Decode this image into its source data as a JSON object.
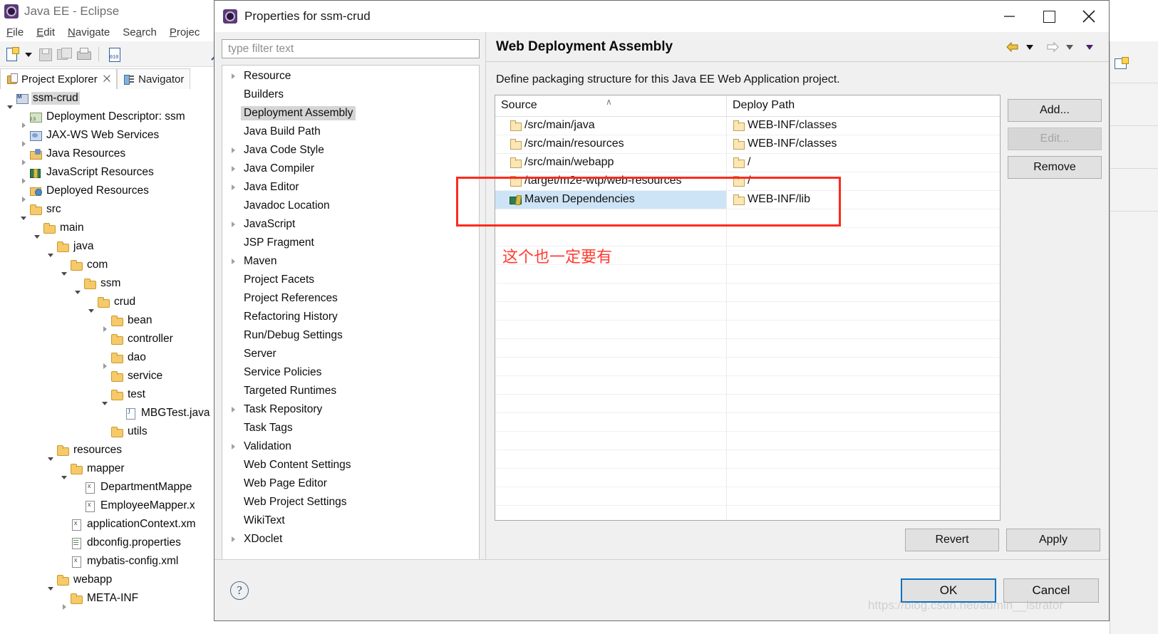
{
  "eclipse": {
    "window_title": "Java EE - Eclipse",
    "logo_icon": "eclipse-logo-icon",
    "menus": [
      {
        "label": "File",
        "mnemonic": "F"
      },
      {
        "label": "Edit",
        "mnemonic": "E"
      },
      {
        "label": "Navigate",
        "mnemonic": "N"
      },
      {
        "label": "Search",
        "mnemonic": "a"
      },
      {
        "label": "Projec",
        "mnemonic": "P"
      }
    ],
    "toolbar_icons": [
      "new-file-icon",
      "dropdown-caret-icon",
      "save-icon",
      "save-all-icon",
      "print-icon",
      "separator",
      "binary-file-icon",
      "skip-breakpoints-icon",
      "separator",
      "run-icon",
      "pause-icon"
    ],
    "tabs": [
      {
        "label": "Project Explorer",
        "icon": "project-explorer-icon",
        "active": true,
        "close": "⨉"
      },
      {
        "label": "Navigator",
        "icon": "navigator-icon",
        "active": false
      }
    ],
    "tree": [
      {
        "label": "ssm-crud",
        "depth": 0,
        "twist": "open",
        "icon": "maven-project-icon",
        "selected": true
      },
      {
        "label": "Deployment Descriptor: ssm",
        "depth": 1,
        "twist": "closed",
        "icon": "deployment-descriptor-icon",
        "selected": false
      },
      {
        "label": "JAX-WS Web Services",
        "depth": 1,
        "twist": "closed",
        "icon": "jaxws-icon",
        "selected": false
      },
      {
        "label": "Java Resources",
        "depth": 1,
        "twist": "closed",
        "icon": "java-resources-icon",
        "selected": false
      },
      {
        "label": "JavaScript Resources",
        "depth": 1,
        "twist": "closed",
        "icon": "javascript-resources-icon",
        "selected": false
      },
      {
        "label": "Deployed Resources",
        "depth": 1,
        "twist": "closed",
        "icon": "deployed-resources-icon",
        "selected": false
      },
      {
        "label": "src",
        "depth": 1,
        "twist": "open",
        "icon": "folder-icon",
        "selected": false
      },
      {
        "label": "main",
        "depth": 2,
        "twist": "open",
        "icon": "folder-icon",
        "selected": false
      },
      {
        "label": "java",
        "depth": 3,
        "twist": "open",
        "icon": "folder-icon",
        "selected": false
      },
      {
        "label": "com",
        "depth": 4,
        "twist": "open",
        "icon": "folder-icon",
        "selected": false
      },
      {
        "label": "ssm",
        "depth": 5,
        "twist": "open",
        "icon": "folder-icon",
        "selected": false
      },
      {
        "label": "crud",
        "depth": 6,
        "twist": "open",
        "icon": "folder-icon",
        "selected": false
      },
      {
        "label": "bean",
        "depth": 7,
        "twist": "closed",
        "icon": "folder-icon",
        "selected": false
      },
      {
        "label": "controller",
        "depth": 7,
        "twist": "none",
        "icon": "folder-icon",
        "selected": false
      },
      {
        "label": "dao",
        "depth": 7,
        "twist": "closed",
        "icon": "folder-icon",
        "selected": false
      },
      {
        "label": "service",
        "depth": 7,
        "twist": "none",
        "icon": "folder-icon",
        "selected": false
      },
      {
        "label": "test",
        "depth": 7,
        "twist": "open",
        "icon": "folder-icon",
        "selected": false
      },
      {
        "label": "MBGTest.java",
        "depth": 8,
        "twist": "none",
        "icon": "java-file-icon",
        "selected": false
      },
      {
        "label": "utils",
        "depth": 7,
        "twist": "none",
        "icon": "folder-icon",
        "selected": false
      },
      {
        "label": "resources",
        "depth": 3,
        "twist": "open",
        "icon": "folder-icon",
        "selected": false
      },
      {
        "label": "mapper",
        "depth": 4,
        "twist": "open",
        "icon": "folder-icon",
        "selected": false
      },
      {
        "label": "DepartmentMappe",
        "depth": 5,
        "twist": "none",
        "icon": "xml-file-icon",
        "selected": false
      },
      {
        "label": "EmployeeMapper.x",
        "depth": 5,
        "twist": "none",
        "icon": "xml-file-icon",
        "selected": false
      },
      {
        "label": "applicationContext.xm",
        "depth": 4,
        "twist": "none",
        "icon": "xml-file-icon",
        "selected": false
      },
      {
        "label": "dbconfig.properties",
        "depth": 4,
        "twist": "none",
        "icon": "properties-file-icon",
        "selected": false
      },
      {
        "label": "mybatis-config.xml",
        "depth": 4,
        "twist": "none",
        "icon": "xml-file-icon",
        "selected": false
      },
      {
        "label": "webapp",
        "depth": 3,
        "twist": "open",
        "icon": "folder-icon",
        "selected": false
      },
      {
        "label": "META-INF",
        "depth": 4,
        "twist": "closed",
        "icon": "folder-icon",
        "selected": false
      }
    ]
  },
  "dialog": {
    "title": "Properties for ssm-crud",
    "icon": "eclipse-logo-icon",
    "window_buttons": [
      {
        "name": "minimize-button",
        "glyph": "—"
      },
      {
        "name": "maximize-button",
        "glyph": "□"
      },
      {
        "name": "close-button",
        "glyph": "✕"
      }
    ],
    "filter": {
      "value": "",
      "placeholder": "type filter text"
    },
    "prefs": [
      {
        "label": "Resource",
        "expandable": true,
        "selected": false
      },
      {
        "label": "Builders",
        "expandable": false,
        "selected": false
      },
      {
        "label": "Deployment Assembly",
        "expandable": false,
        "selected": true
      },
      {
        "label": "Java Build Path",
        "expandable": false,
        "selected": false
      },
      {
        "label": "Java Code Style",
        "expandable": true,
        "selected": false
      },
      {
        "label": "Java Compiler",
        "expandable": true,
        "selected": false
      },
      {
        "label": "Java Editor",
        "expandable": true,
        "selected": false
      },
      {
        "label": "Javadoc Location",
        "expandable": false,
        "selected": false
      },
      {
        "label": "JavaScript",
        "expandable": true,
        "selected": false
      },
      {
        "label": "JSP Fragment",
        "expandable": false,
        "selected": false
      },
      {
        "label": "Maven",
        "expandable": true,
        "selected": false
      },
      {
        "label": "Project Facets",
        "expandable": false,
        "selected": false
      },
      {
        "label": "Project References",
        "expandable": false,
        "selected": false
      },
      {
        "label": "Refactoring History",
        "expandable": false,
        "selected": false
      },
      {
        "label": "Run/Debug Settings",
        "expandable": false,
        "selected": false
      },
      {
        "label": "Server",
        "expandable": false,
        "selected": false
      },
      {
        "label": "Service Policies",
        "expandable": false,
        "selected": false
      },
      {
        "label": "Targeted Runtimes",
        "expandable": false,
        "selected": false
      },
      {
        "label": "Task Repository",
        "expandable": true,
        "selected": false
      },
      {
        "label": "Task Tags",
        "expandable": false,
        "selected": false
      },
      {
        "label": "Validation",
        "expandable": true,
        "selected": false
      },
      {
        "label": "Web Content Settings",
        "expandable": false,
        "selected": false
      },
      {
        "label": "Web Page Editor",
        "expandable": false,
        "selected": false
      },
      {
        "label": "Web Project Settings",
        "expandable": false,
        "selected": false
      },
      {
        "label": "WikiText",
        "expandable": false,
        "selected": false
      },
      {
        "label": "XDoclet",
        "expandable": true,
        "selected": false
      }
    ],
    "page": {
      "title": "Web Deployment Assembly",
      "description": "Define packaging structure for this Java EE Web Application project.",
      "nav_icons": [
        "back-arrow-icon",
        "back-dropdown-icon",
        "forward-arrow-icon",
        "forward-dropdown-icon",
        "menu-dropdown-icon"
      ],
      "table": {
        "columns": [
          "Source",
          "Deploy Path"
        ],
        "sort_indicator": "∧",
        "rows": [
          {
            "source": "/src/main/java",
            "source_icon": "folder-icon",
            "deploy": "WEB-INF/classes",
            "deploy_icon": "folder-icon",
            "selected": false
          },
          {
            "source": "/src/main/resources",
            "source_icon": "folder-icon",
            "deploy": "WEB-INF/classes",
            "deploy_icon": "folder-icon",
            "selected": false
          },
          {
            "source": "/src/main/webapp",
            "source_icon": "folder-icon",
            "deploy": "/",
            "deploy_icon": "folder-icon",
            "selected": false
          },
          {
            "source": "/target/m2e-wtp/web-resources",
            "source_icon": "folder-icon",
            "deploy": "/",
            "deploy_icon": "folder-icon",
            "selected": false
          },
          {
            "source": "Maven Dependencies",
            "source_icon": "maven-dependencies-icon",
            "deploy": "WEB-INF/lib",
            "deploy_icon": "folder-icon",
            "selected": true
          }
        ]
      },
      "side_buttons": [
        {
          "label": "Add...",
          "enabled": true
        },
        {
          "label": "Edit...",
          "enabled": false
        },
        {
          "label": "Remove",
          "enabled": true
        }
      ],
      "footer_buttons": [
        {
          "label": "Revert"
        },
        {
          "label": "Apply"
        }
      ]
    },
    "bottom": {
      "help_icon": "help-question-icon",
      "help_glyph": "?",
      "ok_label": "OK",
      "cancel_label": "Cancel"
    }
  },
  "annotations": {
    "chinese_note": "这个也一定要有",
    "highlight_color": "#ff2a1f",
    "watermark": "https://blog.csdn.net/admin__istrator"
  }
}
